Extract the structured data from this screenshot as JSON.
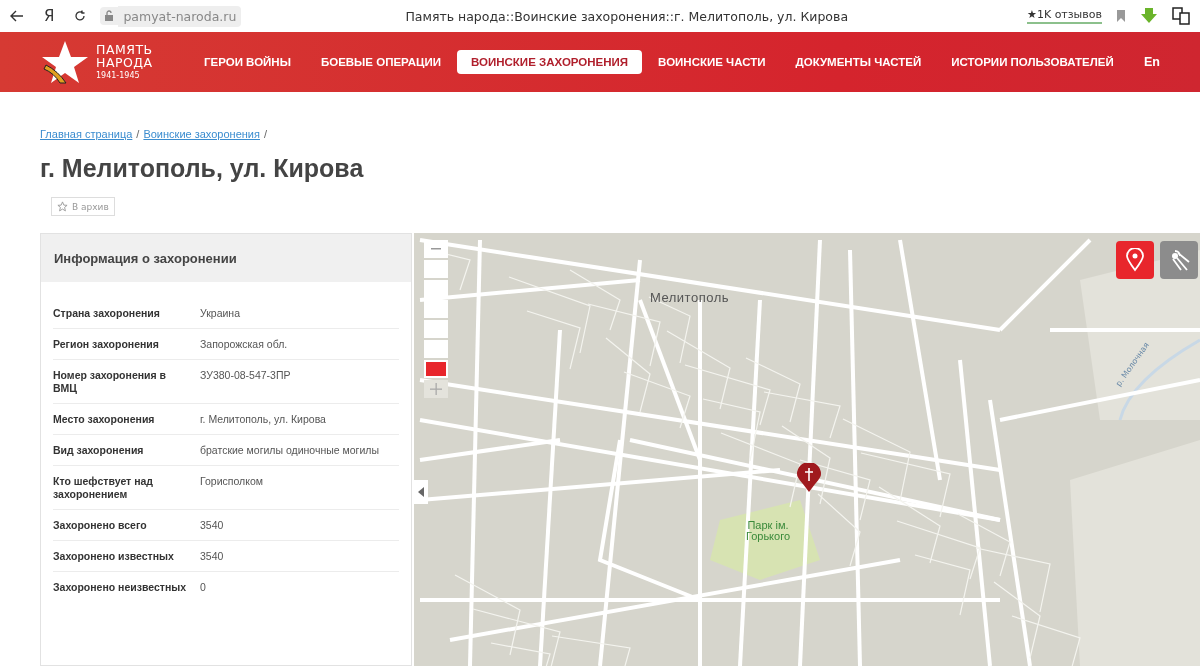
{
  "browser": {
    "url": "pamyat-naroda.ru",
    "title": "Память народа::Воинские захоронения::г. Мелитополь, ул. Кирова",
    "reviews": "★1K отзывов",
    "yandex": "Я"
  },
  "logo": {
    "line1": "ПАМЯТЬ",
    "line2": "НАРОДА",
    "years": "1941-1945"
  },
  "nav": [
    {
      "label": "ГЕРОИ ВОЙНЫ",
      "selected": false
    },
    {
      "label": "БОЕВЫЕ ОПЕРАЦИИ",
      "selected": false
    },
    {
      "label": "ВОИНСКИЕ ЗАХОРОНЕНИЯ",
      "selected": true
    },
    {
      "label": "ВОИНСКИЕ ЧАСТИ",
      "selected": false
    },
    {
      "label": "ДОКУМЕНТЫ ЧАСТЕЙ",
      "selected": false
    },
    {
      "label": "ИСТОРИИ ПОЛЬЗОВАТЕЛЕЙ",
      "selected": false
    }
  ],
  "language": "En",
  "breadcrumbs": [
    "Главная страница",
    "Воинские захоронения"
  ],
  "breadcrumb_separator": "/",
  "page_title": "г. Мелитополь, ул. Кирова",
  "archive_button": "В архив",
  "info": {
    "title": "Информация о захоронении",
    "rows": [
      {
        "label": "Страна захоронения",
        "value": "Украина"
      },
      {
        "label": "Регион захоронения",
        "value": "Запорожская обл."
      },
      {
        "label": "Номер захоронения в ВМЦ",
        "value": "ЗУ380-08-547-3ПР"
      },
      {
        "label": "Место захоронения",
        "value": "г. Мелитополь, ул. Кирова"
      },
      {
        "label": "Вид захоронения",
        "value": "братские могилы одиночные могилы"
      },
      {
        "label": "Кто шефствует над захоронением",
        "value": "Горисполком"
      },
      {
        "label": "Захоронено всего",
        "value": "3540"
      },
      {
        "label": "Захоронено известных",
        "value": "3540"
      },
      {
        "label": "Захоронено неизвестных",
        "value": "0"
      }
    ]
  },
  "map": {
    "city_label": "Мелитополь",
    "park_label": "Парк ім. Горького",
    "river_label": "р. Молочная",
    "zoom_steps": [
      {
        "selected": false
      },
      {
        "selected": false
      },
      {
        "selected": false
      },
      {
        "selected": false
      },
      {
        "selected": false
      },
      {
        "selected": true
      }
    ],
    "mode_buttons": [
      {
        "kind": "pin",
        "selected": true
      },
      {
        "kind": "satellite",
        "selected": false
      }
    ]
  }
}
